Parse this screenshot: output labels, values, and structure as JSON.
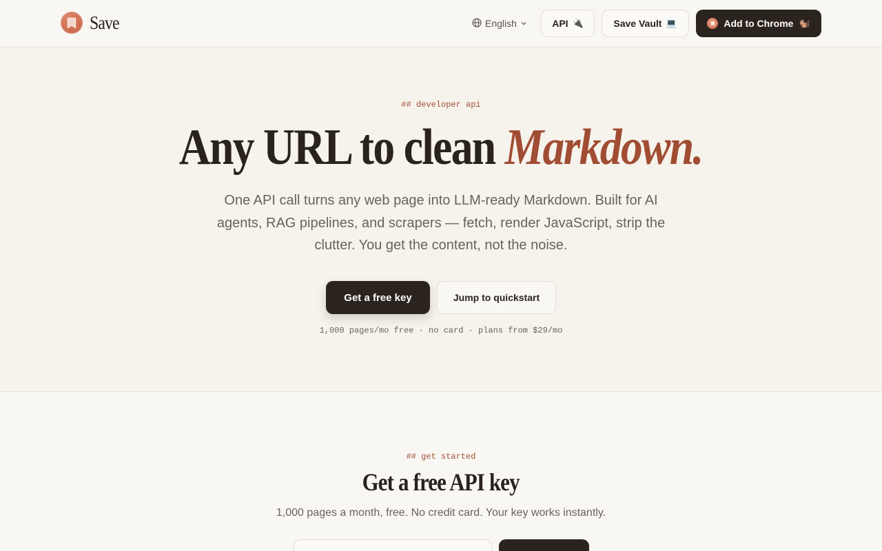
{
  "header": {
    "brand": "Save",
    "language": "English",
    "api_label": "API",
    "api_emoji": "🔌",
    "vault_label": "Save Vault",
    "vault_emoji": "💻",
    "chrome_label": "Add to Chrome",
    "chrome_emoji": "🐿️"
  },
  "hero": {
    "eyebrow": "## developer api",
    "title_plain": "Any URL to clean ",
    "title_accent": "Markdown.",
    "description": "One API call turns any web page into LLM-ready Markdown. Built for AI agents, RAG pipelines, and scrapers — fetch, render JavaScript, strip the clutter. You get the content, not the noise.",
    "primary_cta": "Get a free key",
    "secondary_cta": "Jump to quickstart",
    "fineprint": "1,000 pages/mo free · no card · plans from $29/mo"
  },
  "get_started": {
    "eyebrow": "## get started",
    "title": "Get a free API key",
    "description": "1,000 pages a month, free. No credit card. Your key works instantly."
  },
  "colors": {
    "accent": "#a04d33",
    "dark": "#2b231e",
    "background": "#f9f7f3",
    "hero_background": "#f6f2ec"
  },
  "icons": {
    "logo": "bookmark-icon",
    "language": "globe-icon",
    "dropdown": "chevron-down-icon"
  }
}
